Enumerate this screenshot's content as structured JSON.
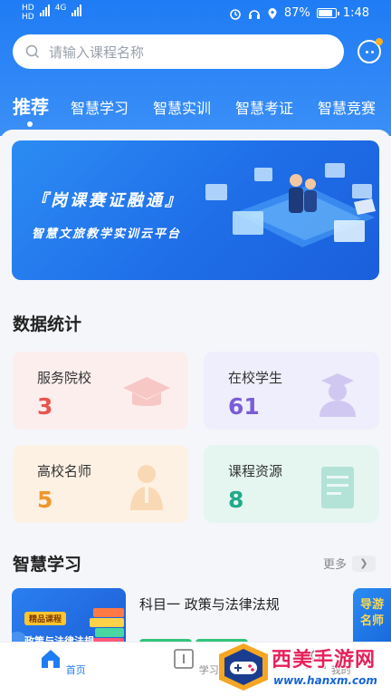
{
  "status_bar": {
    "left": [
      "HD",
      "4G",
      "HD",
      "4G"
    ],
    "battery": "87%",
    "time": "1:48"
  },
  "search": {
    "placeholder": "请输入课程名称"
  },
  "tabs": [
    {
      "label": "推荐",
      "active": true
    },
    {
      "label": "智慧学习"
    },
    {
      "label": "智慧实训"
    },
    {
      "label": "智慧考证"
    },
    {
      "label": "智慧竞赛"
    }
  ],
  "banner": {
    "title": "『岗课赛证融通』",
    "subtitle": "智慧文旅教学实训云平台"
  },
  "stats": {
    "title": "数据统计",
    "cards": [
      {
        "label": "服务院校",
        "value": "3",
        "color": "#e8554e",
        "bg": "#fdeeee",
        "icon": "graduation-cap-icon"
      },
      {
        "label": "在校学生",
        "value": "61",
        "color": "#7a5cd6",
        "bg": "#efeefc",
        "icon": "student-icon"
      },
      {
        "label": "高校名师",
        "value": "5",
        "color": "#f0962e",
        "bg": "#fdf1e4",
        "icon": "teacher-icon"
      },
      {
        "label": "课程资源",
        "value": "8",
        "color": "#23a98a",
        "bg": "#e5f6f1",
        "icon": "book-icon"
      }
    ]
  },
  "learning": {
    "title": "智慧学习",
    "more": "更多",
    "courses": [
      {
        "badge": "精品课程",
        "thumb_title": "政策与法律法规",
        "name": "科目一 政策与法律法规"
      },
      {
        "thumb_title": "导游名师"
      }
    ]
  },
  "bottom_nav": [
    {
      "label": "首页",
      "icon": "home-icon",
      "active": true
    },
    {
      "label": "学习",
      "icon": "book-open-icon"
    },
    {
      "label": "我的",
      "icon": "user-icon"
    }
  ],
  "watermark": {
    "title": "西美手游网",
    "url": "www.hanxm.com"
  },
  "colors": {
    "primary": "#1f7cf5",
    "badge": "#ffb020"
  }
}
